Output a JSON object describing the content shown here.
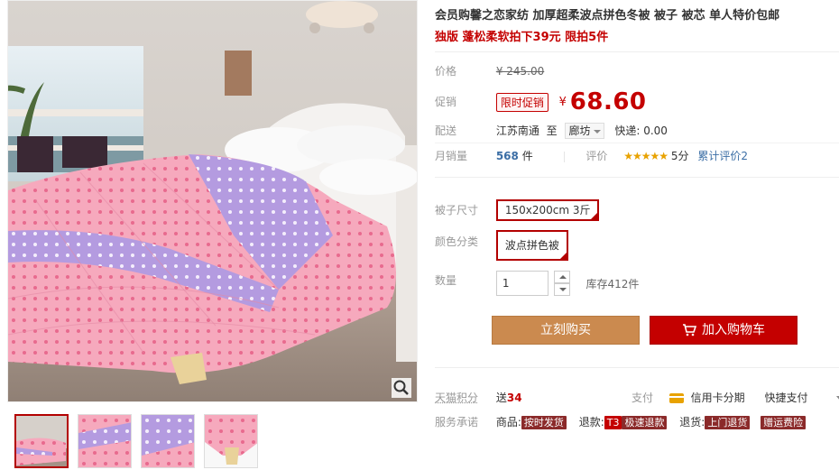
{
  "product": {
    "title": "会员购馨之恋家纺 加厚超柔波点拼色冬被 被子 被芯 单人特价包邮",
    "subtitle": "独版 蓬松柔软拍下39元 限拍5件"
  },
  "price": {
    "label": "价格",
    "original": "¥ 245.00",
    "promo_label": "促销",
    "promo_tag": "限时促销",
    "currency": "¥",
    "promo_price": "68.60"
  },
  "shipping": {
    "label": "配送",
    "from": "江苏南通",
    "to_word": "至",
    "city": "廊坊",
    "express": "快递: 0.00"
  },
  "sales": {
    "label": "月销量",
    "count": "568",
    "unit": "件",
    "rating_label": "评价",
    "stars": "★★★★★",
    "score": "5分",
    "review_link": "累计评价2"
  },
  "sku": {
    "size_label": "被子尺寸",
    "size_value": "150x200cm 3斤",
    "color_label": "颜色分类",
    "color_value": "波点拼色被",
    "qty_label": "数量",
    "qty_value": "1",
    "stock": "库存412件"
  },
  "actions": {
    "buy": "立刻购买",
    "cart": "加入购物车"
  },
  "extras": {
    "points_label": "天猫积分",
    "points_prefix": "送",
    "points_value": "34",
    "pay_label": "支付",
    "pay_credit": "信用卡分期",
    "pay_fast": "快捷支付",
    "service_label": "服务承诺",
    "svc_goods_label": "商品:",
    "svc_goods_tag": "按时发货",
    "svc_refund_label": "退款:",
    "svc_refund_badge": "T3",
    "svc_refund_tag": "极速退款",
    "svc_return_label": "退货:",
    "svc_return_tag": "上门退货",
    "svc_insure_tag": "赠运费险"
  },
  "colors": {
    "accent_red": "#c40000",
    "buy_orange": "#cb8a4f",
    "link_blue": "#3b6ea5",
    "star_gold": "#e8a200"
  },
  "icons": [
    "zoom-icon",
    "cart-icon",
    "credit-card-icon",
    "chevron-down-icon"
  ]
}
